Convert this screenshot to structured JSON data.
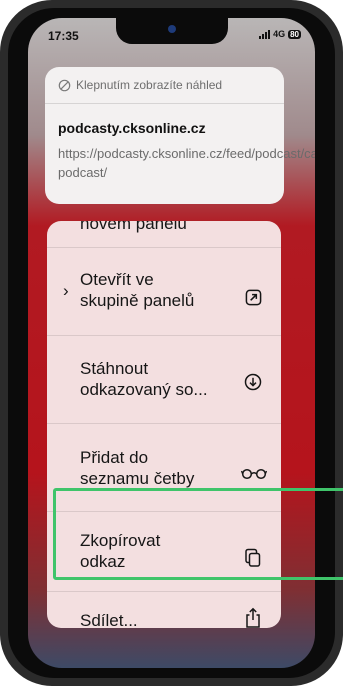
{
  "status": {
    "time": "17:35",
    "network": "4G",
    "battery": "80"
  },
  "preview": {
    "tap_hint": "Klepnutím zobrazíte náhled",
    "domain": "podcasty.cksonline.cz",
    "url": "https://podcasty.cksonline.cz/feed/podcast/cardio-podcast/"
  },
  "menu": {
    "items": [
      {
        "label": "novém panelu"
      },
      {
        "label_line1": "Otevřít ve",
        "label_line2": "skupině panelů",
        "icon": "open-in-group-icon"
      },
      {
        "label_line1": "Stáhnout",
        "label_line2": "odkazovaný so...",
        "icon": "download-icon"
      },
      {
        "label_line1": "Přidat do",
        "label_line2": "seznamu četby",
        "icon": "reading-list-glasses-icon"
      },
      {
        "label_line1": "Zkopírovat",
        "label_line2": "odkaz",
        "icon": "copy-icon"
      },
      {
        "label": "Sdílet...",
        "icon": "share-icon"
      }
    ]
  },
  "colors": {
    "highlight": "#3fc46a",
    "background": "#b5141c"
  }
}
